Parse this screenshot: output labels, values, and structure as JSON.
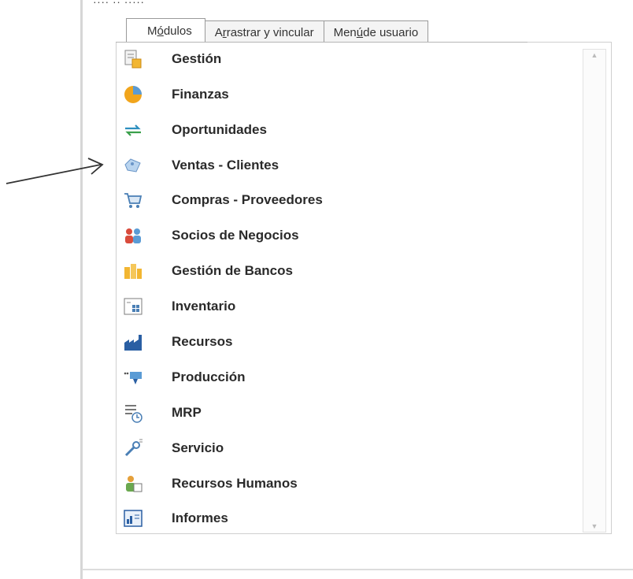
{
  "header": {
    "caption": "····  ··  ·····"
  },
  "tabs": [
    {
      "label_pre": "M",
      "label_u": "ó",
      "label_post": "dulos",
      "active": true
    },
    {
      "label_pre": "A",
      "label_u": "r",
      "label_post": "rastrar y vincular",
      "active": false
    },
    {
      "label_pre": "Men",
      "label_u": "ú",
      "label_post": " de usuario",
      "active": false
    }
  ],
  "modules": [
    {
      "label": "Gestión",
      "icon": "gestion-icon"
    },
    {
      "label": "Finanzas",
      "icon": "finanzas-icon"
    },
    {
      "label": "Oportunidades",
      "icon": "oportunidades-icon"
    },
    {
      "label": "Ventas - Clientes",
      "icon": "ventas-clientes-icon"
    },
    {
      "label": "Compras - Proveedores",
      "icon": "shopping-cart-icon"
    },
    {
      "label": "Socios de Negocios",
      "icon": "business-partners-icon"
    },
    {
      "label": "Gestión de Bancos",
      "icon": "banks-icon"
    },
    {
      "label": "Inventario",
      "icon": "inventory-icon"
    },
    {
      "label": "Recursos",
      "icon": "resources-icon"
    },
    {
      "label": "Producción",
      "icon": "production-icon"
    },
    {
      "label": "MRP",
      "icon": "mrp-icon"
    },
    {
      "label": "Servicio",
      "icon": "service-icon"
    },
    {
      "label": "Recursos Humanos",
      "icon": "human-resources-icon"
    },
    {
      "label": "Informes",
      "icon": "reports-icon"
    }
  ]
}
